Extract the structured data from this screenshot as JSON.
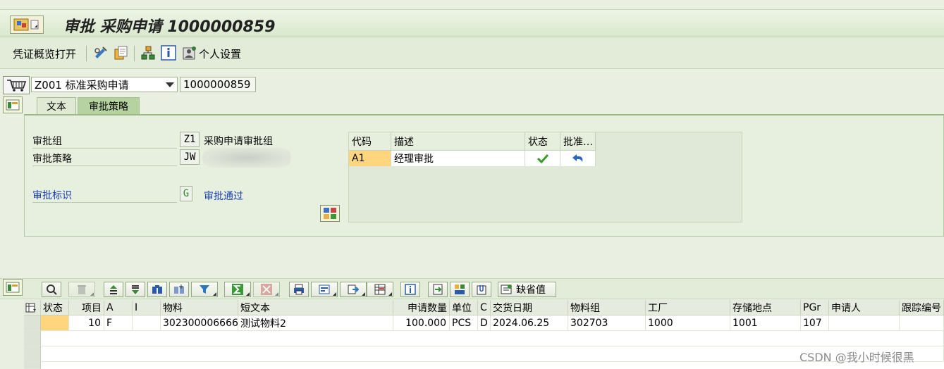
{
  "title": {
    "text": "审批 采购申请 1000000859"
  },
  "toolbar": {
    "voucher_overview": "凭证概览打开",
    "personal_settings": "个人设置"
  },
  "header": {
    "doc_type": "Z001 标准采购申请",
    "doc_number": "1000000859"
  },
  "tabs": [
    "文本",
    "审批策略"
  ],
  "approval": {
    "group_label": "审批组",
    "group_code": "Z1",
    "group_desc": "采购申请审批组",
    "strategy_label": "审批策略",
    "strategy_code": "JW",
    "indicator_label": "审批标识",
    "indicator_code": "G",
    "indicator_desc": "审批通过"
  },
  "strategy_table": {
    "headers": [
      "代码",
      "描述",
      "状态",
      "批准…"
    ],
    "rows": [
      {
        "code": "A1",
        "desc": "经理审批"
      }
    ]
  },
  "gridbar": {
    "default_value": "缺省值"
  },
  "grid": {
    "headers": [
      "状态",
      "项目",
      "A",
      "I",
      "物料",
      "短文本",
      "申请数量",
      "单位",
      "C",
      "交货日期",
      "物料组",
      "工厂",
      "存储地点",
      "PGr",
      "申请人",
      "跟踪编号"
    ],
    "row": {
      "status": "",
      "item": "10",
      "a": "F",
      "i": "",
      "material": "302300006666",
      "short_text": "测试物料2",
      "qty": "100.000",
      "unit": "PCS",
      "c": "D",
      "delivery_date": "2024.06.25",
      "mat_group": "302703",
      "plant": "1000",
      "storage": "1001",
      "pgr": "107",
      "requester": "",
      "tracking": ""
    }
  },
  "watermark": "CSDN @我小时候很黑",
  "colors": {
    "accent": "#b7d2a1",
    "selected_cell": "#ffd57e",
    "check_green": "#3a9a2a"
  }
}
